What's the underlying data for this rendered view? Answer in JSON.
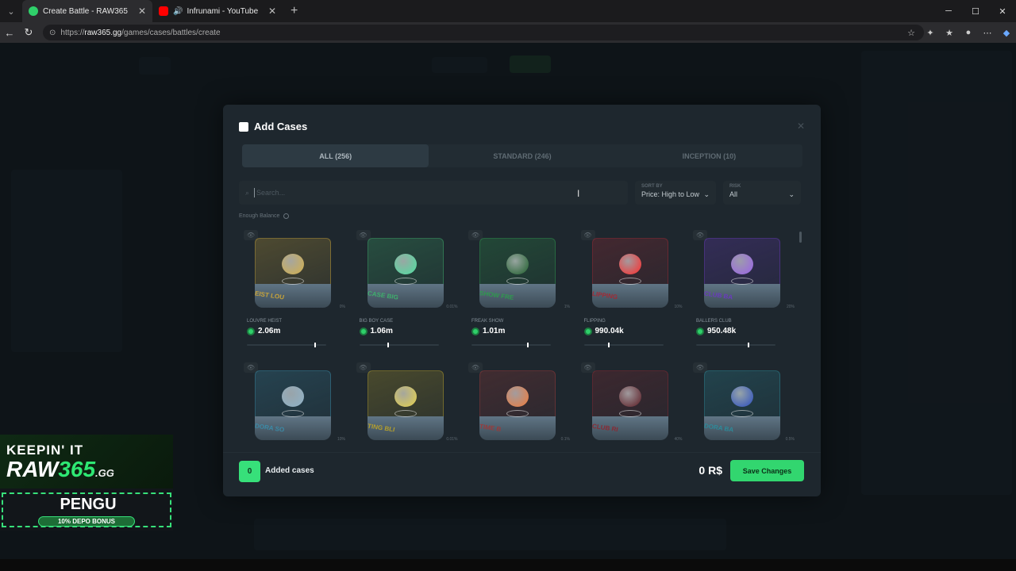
{
  "browser": {
    "tabs": [
      {
        "title": "Create Battle - RAW365",
        "favicon_color": "#2fd06a"
      },
      {
        "title": "Infrunami - YouTube",
        "favicon_color": "#ff0000"
      }
    ],
    "url_prefix": "https://",
    "url_domain": "raw365.gg",
    "url_path": "/games/cases/battles/create"
  },
  "modal": {
    "title": "Add Cases",
    "tabs": [
      "ALL (256)",
      "STANDARD (246)",
      "INCEPTION (10)"
    ],
    "search_placeholder": "Search...",
    "sort_label": "SORT BY",
    "sort_value": "Price: High to Low",
    "risk_label": "RISK",
    "risk_value": "All",
    "enough_balance": "Enough Balance",
    "cases": [
      {
        "name": "LOUVRE HEIST",
        "price": "2.06m",
        "pct": "0%",
        "banner": "EIST LOU",
        "color": "#c7a33a",
        "gem": "#d4b04a",
        "risk": 0.85
      },
      {
        "name": "BIG BOY CASE",
        "price": "1.06m",
        "pct": "0.01%",
        "banner": "CASE BIG",
        "color": "#3fae6d",
        "gem": "#4ee0a0",
        "risk": 0.35
      },
      {
        "name": "FREAK SHOW",
        "price": "1.01m",
        "pct": "1%",
        "banner": "SHOW FRE",
        "color": "#2f9a4e",
        "gem": "#1f5f2c",
        "risk": 0.7
      },
      {
        "name": "FLIPPING",
        "price": "990.04k",
        "pct": "10%",
        "banner": "LIPPING",
        "color": "#a22a35",
        "gem": "#ff2b2b",
        "risk": 0.3
      },
      {
        "name": "BALLERS CLUB",
        "price": "950.48k",
        "pct": "20%",
        "banner": "CLUB BA",
        "color": "#6a3bbd",
        "gem": "#9a62e8",
        "risk": 0.65
      },
      {
        "name": "",
        "price": "",
        "pct": "10%",
        "banner": "DORA SO",
        "color": "#3b8aa6",
        "gem": "#8fb3c9",
        "risk": 0
      },
      {
        "name": "",
        "price": "",
        "pct": "0.01%",
        "banner": "TING BLI",
        "color": "#b5a02c",
        "gem": "#e7d34a",
        "risk": 0
      },
      {
        "name": "",
        "price": "",
        "pct": "0.1%",
        "banner": "TIME B",
        "color": "#9a3a3a",
        "gem": "#f07a3a",
        "risk": 0
      },
      {
        "name": "",
        "price": "",
        "pct": "40%",
        "banner": "CLUB RI",
        "color": "#8a2a33",
        "gem": "#5a1a22",
        "risk": 0
      },
      {
        "name": "",
        "price": "",
        "pct": "0.5%",
        "banner": "DORA BA",
        "color": "#2d8a9a",
        "gem": "#2a4fc0",
        "risk": 0
      }
    ],
    "added_count": "0",
    "added_label": "Added cases",
    "total": "0 R$",
    "save_label": "Save Changes"
  },
  "promo": {
    "headline": "KEEPIN' IT",
    "brand_a": "RAW",
    "brand_b": "365",
    "brand_tld": ".GG",
    "code": "PENGU",
    "bonus": "10% DEPO BONUS"
  }
}
